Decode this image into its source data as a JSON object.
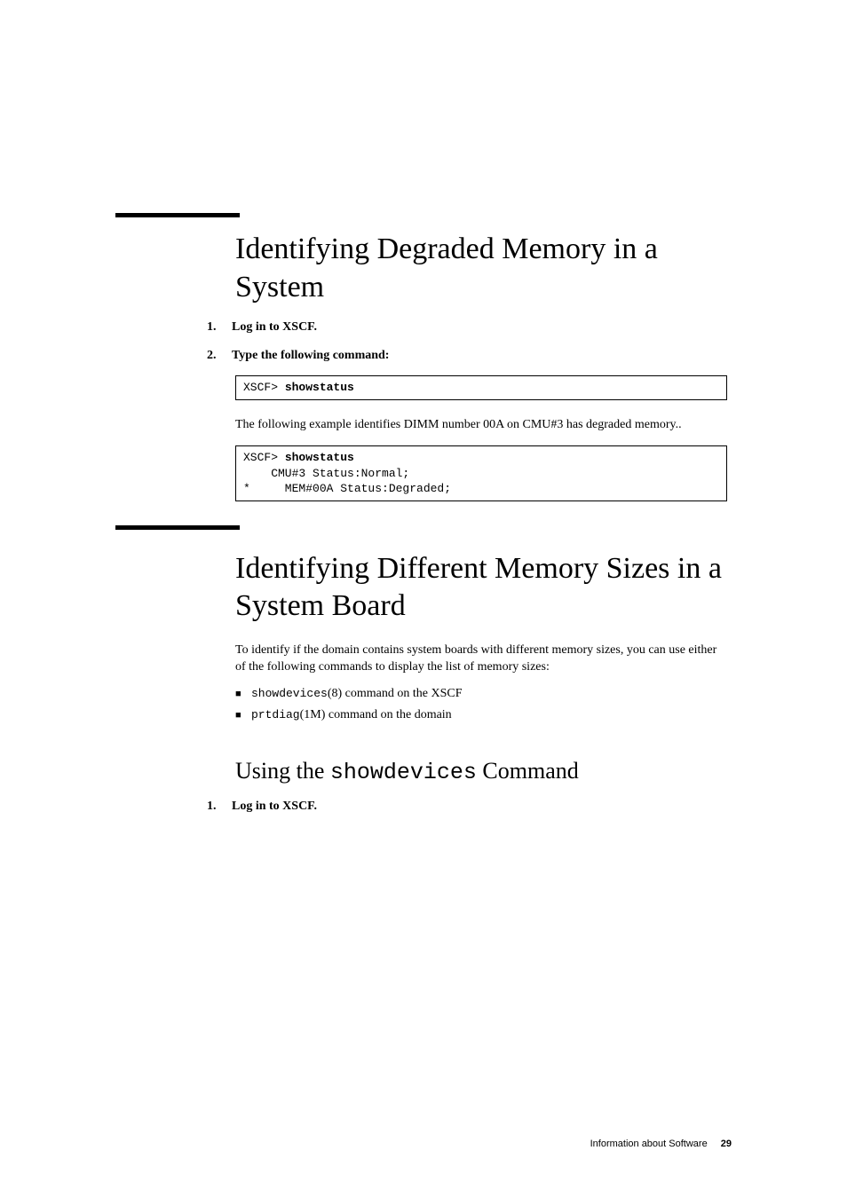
{
  "section1": {
    "heading": "Identifying Degraded Memory in a System",
    "step1_num": "1.",
    "step1_text": "Log in to XSCF.",
    "step2_num": "2.",
    "step2_text": "Type the following command:",
    "code1_prompt": "XSCF> ",
    "code1_cmd": "showstatus",
    "para1": "The following example identifies DIMM number 00A on CMU#3 has degraded memory..",
    "code2_prompt": "XSCF> ",
    "code2_cmd": "showstatus",
    "code2_line2": "    CMU#3 Status:Normal;",
    "code2_line3": "*     MEM#00A Status:Degraded;"
  },
  "section2": {
    "heading": "Identifying Different Memory Sizes in a System Board",
    "para1": "To identify if the domain contains system boards with different memory sizes, you can use either of the following commands to display the list of memory sizes:",
    "bullet1_code": "showdevices",
    "bullet1_rest": "(8) command on the XSCF",
    "bullet2_code": "prtdiag",
    "bullet2_rest": "(1M) command on the domain",
    "sub_heading_pre": "Using the ",
    "sub_heading_code": "showdevices",
    "sub_heading_post": " Command",
    "step1_num": "1.",
    "step1_text": "Log in to XSCF."
  },
  "footer": {
    "text": "Information about Software",
    "page": "29"
  }
}
